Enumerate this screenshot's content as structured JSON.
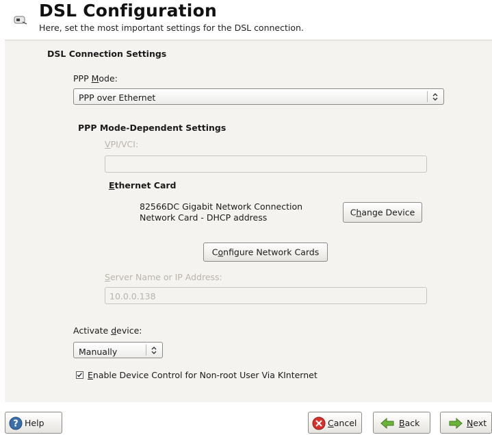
{
  "header": {
    "title": "DSL Configuration",
    "subtitle": "Here, set the most important settings for the DSL connection.",
    "icon": "network-device-icon"
  },
  "dsl": {
    "section_title": "DSL Connection Settings",
    "ppp_mode_label_pre": "PPP ",
    "ppp_mode_label_acc": "M",
    "ppp_mode_label_post": "ode:",
    "ppp_mode_value": "PPP over Ethernet",
    "dependent_title": "PPP Mode-Dependent Settings",
    "vpi_label_acc": "V",
    "vpi_label_post": "PI/VCI:",
    "vpi_value": "",
    "ethernet_card_acc": "E",
    "ethernet_card_post": "thernet Card",
    "card_line1": "82566DC Gigabit Network Connection",
    "card_line2": "Network Card - DHCP address",
    "change_device_pre": "C",
    "change_device_acc": "h",
    "change_device_post": "ange Device",
    "configure_pre": "C",
    "configure_acc": "o",
    "configure_post": "nfigure Network Cards",
    "server_label_acc": "S",
    "server_label_post": "erver Name or IP Address:",
    "server_value": "10.0.0.138",
    "activate_label_pre": "Activate ",
    "activate_label_acc": "d",
    "activate_label_post": "evice:",
    "activate_value": "Manually",
    "enable_checked": true,
    "enable_acc": "E",
    "enable_post": "nable Device Control for Non-root User Via KInternet"
  },
  "footer": {
    "help": "Help",
    "cancel_acc": "C",
    "cancel_post": "ancel",
    "back_acc": "B",
    "back_post": "ack",
    "next_acc": "N",
    "next_post": "ext"
  },
  "colors": {
    "panel_bg": "#f5f3ef",
    "disabled_text": "#b8b3ab"
  }
}
